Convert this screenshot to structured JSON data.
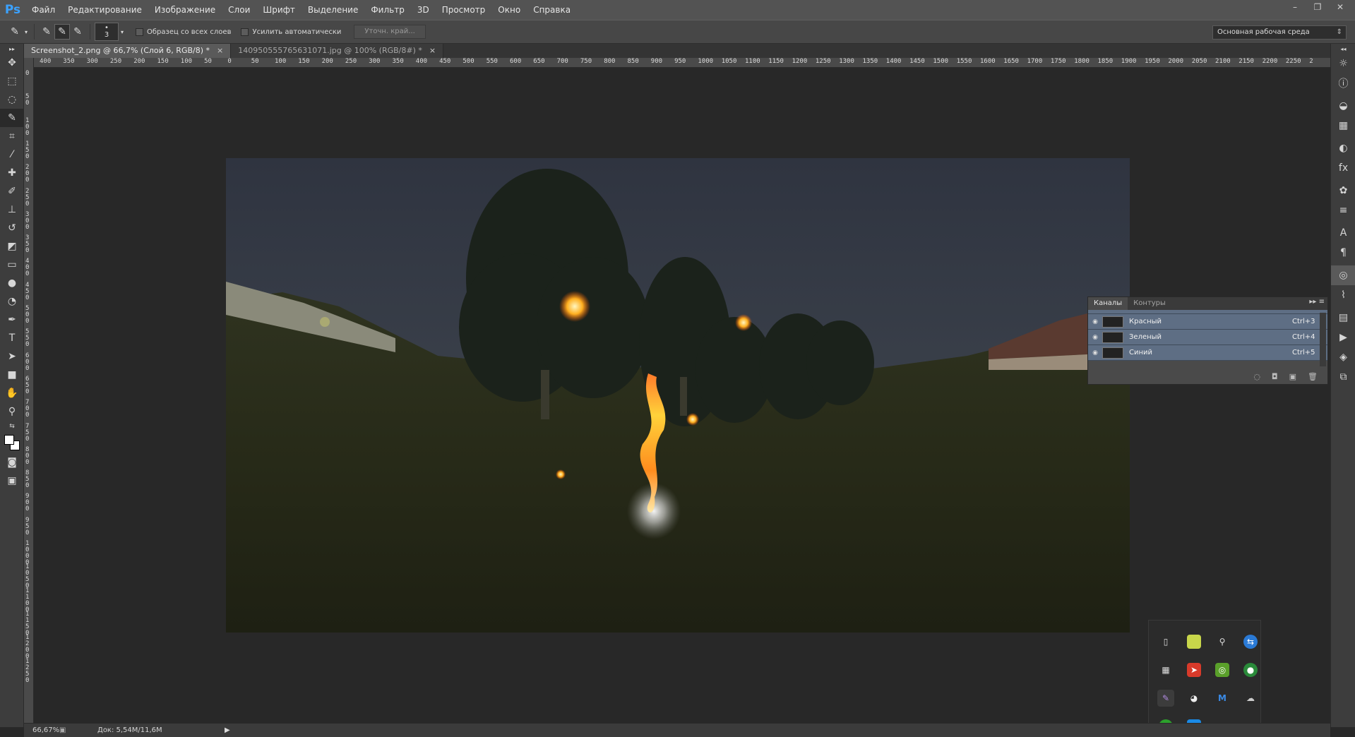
{
  "app": {
    "logo": "Ps"
  },
  "menu": [
    "Файл",
    "Редактирование",
    "Изображение",
    "Слои",
    "Шрифт",
    "Выделение",
    "Фильтр",
    "3D",
    "Просмотр",
    "Окно",
    "Справка"
  ],
  "options": {
    "brush_size": "3",
    "sample_all_layers": "Образец со всех слоев",
    "auto_enhance": "Усилить автоматически",
    "refine_edge": "Уточн. край...",
    "workspace": "Основная рабочая среда"
  },
  "tabs": [
    {
      "label": "Screenshot_2.png @ 66,7% (Слой 6, RGB/8) *",
      "close": "×"
    },
    {
      "label": "140950555765631071.jpg @ 100% (RGB/8#) *",
      "close": "×"
    }
  ],
  "ruler_h": [
    "400",
    "350",
    "300",
    "250",
    "200",
    "150",
    "100",
    "50",
    "0",
    "50",
    "100",
    "150",
    "200",
    "250",
    "300",
    "350",
    "400",
    "450",
    "500",
    "550",
    "600",
    "650",
    "700",
    "750",
    "800",
    "850",
    "900",
    "950",
    "1000",
    "1050",
    "1100",
    "1150",
    "1200",
    "1250",
    "1300",
    "1350",
    "1400",
    "1450",
    "1500",
    "1550",
    "1600",
    "1650",
    "1700",
    "1750",
    "1800",
    "1850",
    "1900",
    "1950",
    "2000",
    "2050",
    "2100",
    "2150",
    "2200",
    "2250",
    "2"
  ],
  "ruler_v": [
    "0",
    "50",
    "100",
    "150",
    "200",
    "250",
    "300",
    "350",
    "400",
    "450",
    "500",
    "550",
    "600",
    "650",
    "700",
    "750",
    "800",
    "850",
    "900",
    "950",
    "1000",
    "1050",
    "1100",
    "1150",
    "1200",
    "1250"
  ],
  "channels": {
    "tabs": [
      "Каналы",
      "Контуры"
    ],
    "rows": [
      {
        "name": "Красный",
        "shortcut": "Ctrl+3"
      },
      {
        "name": "Зеленый",
        "shortcut": "Ctrl+4"
      },
      {
        "name": "Синий",
        "shortcut": "Ctrl+5"
      }
    ]
  },
  "status": {
    "zoom": "66,67%",
    "doc": "Док: 5,54М/11,6М"
  },
  "colors": {
    "accent": "#3ba2ff",
    "channel_row": "#5e6e84"
  }
}
